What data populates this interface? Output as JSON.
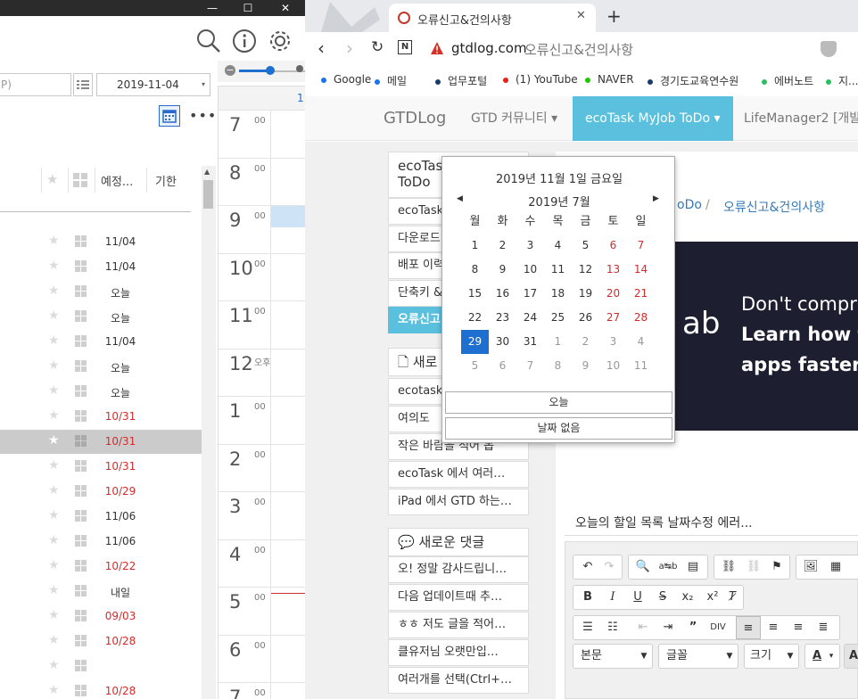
{
  "left_app": {
    "filter_placeholder": "P)",
    "date_value": "2019-11-04",
    "columns": [
      "예정...",
      "기한"
    ],
    "rows": [
      {
        "date": "11/04",
        "overdue": false
      },
      {
        "date": "11/04",
        "overdue": false
      },
      {
        "date": "오늘",
        "overdue": false
      },
      {
        "date": "오늘",
        "overdue": false
      },
      {
        "date": "11/04",
        "overdue": false
      },
      {
        "date": "오늘",
        "overdue": false
      },
      {
        "date": "오늘",
        "overdue": false
      },
      {
        "date": "10/31",
        "overdue": true
      },
      {
        "date": "10/31",
        "overdue": true,
        "selected": true
      },
      {
        "date": "10/31",
        "overdue": true
      },
      {
        "date": "10/29",
        "overdue": true
      },
      {
        "date": "11/06",
        "overdue": false
      },
      {
        "date": "11/06",
        "overdue": false
      },
      {
        "date": "10/22",
        "overdue": true
      },
      {
        "date": "내일",
        "overdue": false
      },
      {
        "date": "09/03",
        "overdue": true
      },
      {
        "date": "10/28",
        "overdue": true
      },
      {
        "date": "",
        "overdue": false
      },
      {
        "date": "10/28",
        "overdue": true
      }
    ],
    "calendar": {
      "top_label": "1",
      "hours": [
        {
          "h": "7",
          "m": "00"
        },
        {
          "h": "8",
          "m": "00"
        },
        {
          "h": "9",
          "m": "00"
        },
        {
          "h": "10",
          "m": "00"
        },
        {
          "h": "11",
          "m": "00"
        },
        {
          "h": "12",
          "m": "오후"
        },
        {
          "h": "1",
          "m": "00"
        },
        {
          "h": "2",
          "m": "00"
        },
        {
          "h": "3",
          "m": "00"
        },
        {
          "h": "4",
          "m": "00"
        },
        {
          "h": "5",
          "m": "00"
        },
        {
          "h": "6",
          "m": "00"
        },
        {
          "h": "7",
          "m": "00"
        }
      ]
    }
  },
  "browser": {
    "tab_title": "오류신고&건의사항",
    "url_domain": "gtdlog.com",
    "url_title": "오류신고&건의사항",
    "bookmarks": [
      {
        "label": "Google",
        "color": "#1a73e8"
      },
      {
        "label": "메일",
        "color": "#1a73e8"
      },
      {
        "label": "업무포털",
        "color": "#1b3a6b"
      },
      {
        "label": "(1) YouTube",
        "color": "#e62117"
      },
      {
        "label": "NAVER",
        "color": "#1ec800"
      },
      {
        "label": "경기도교육연수원",
        "color": "#1b3a6b"
      },
      {
        "label": "에버노트",
        "color": "#2dbe60"
      },
      {
        "label": "지...",
        "color": "#2dbe60"
      }
    ],
    "nav": {
      "brand": "GTDLog",
      "items": [
        "GTD 커뮤니티 ▾",
        "ecoTask MyJob ToDo ▾",
        "LifeManager2 [개발"
      ]
    },
    "sidebar": {
      "title_line1": "ecoTas",
      "title_line2": "ToDo",
      "items": [
        "ecoTask",
        "다운로드",
        "배포 이력",
        "단축키 &"
      ],
      "active": "오류신고",
      "new_posts_title": "새로",
      "posts": [
        "ecotask",
        "여의도 ",
        "작은 바람을 적어 봅",
        "ecoTask 에서 여러…",
        "iPad 에서 GTD 하는…"
      ],
      "new_comments_title": "새로운 댓글",
      "comments": [
        "오! 정말 감사드립니…",
        "다음 업데이트때 추…",
        "ㅎㅎ 저도 글을 적어…",
        "클유저님 오랫만입…",
        "여러개를 선택(Ctrl+…"
      ]
    },
    "breadcrumb": [
      "oDo",
      "/",
      "오류신고&건의사항"
    ],
    "ad": {
      "line1": "Don't compr",
      "line2": "Learn how t",
      "line3": "apps faster.",
      "logo": "ab"
    },
    "post_title": "오늘의 할일 목록 날짜수정 에러...",
    "editor": {
      "style_select": "본문",
      "font_select": "글꼴",
      "size_select": "크기"
    }
  },
  "datepicker": {
    "full_date": "2019년 11월 1일 금요일",
    "month_label": "2019년 7월",
    "weekdays": [
      "월",
      "화",
      "수",
      "목",
      "금",
      "토",
      "일"
    ],
    "weeks": [
      [
        "1",
        "2",
        "3",
        "4",
        "5",
        "6",
        "7"
      ],
      [
        "8",
        "9",
        "10",
        "11",
        "12",
        "13",
        "14"
      ],
      [
        "15",
        "16",
        "17",
        "18",
        "19",
        "20",
        "21"
      ],
      [
        "22",
        "23",
        "24",
        "25",
        "26",
        "27",
        "28"
      ],
      [
        "29",
        "30",
        "31",
        "1",
        "2",
        "3",
        "4"
      ],
      [
        "5",
        "6",
        "7",
        "8",
        "9",
        "10",
        "11"
      ]
    ],
    "selected": "29",
    "today_button": "오늘",
    "no_date_button": "날짜 없음"
  }
}
